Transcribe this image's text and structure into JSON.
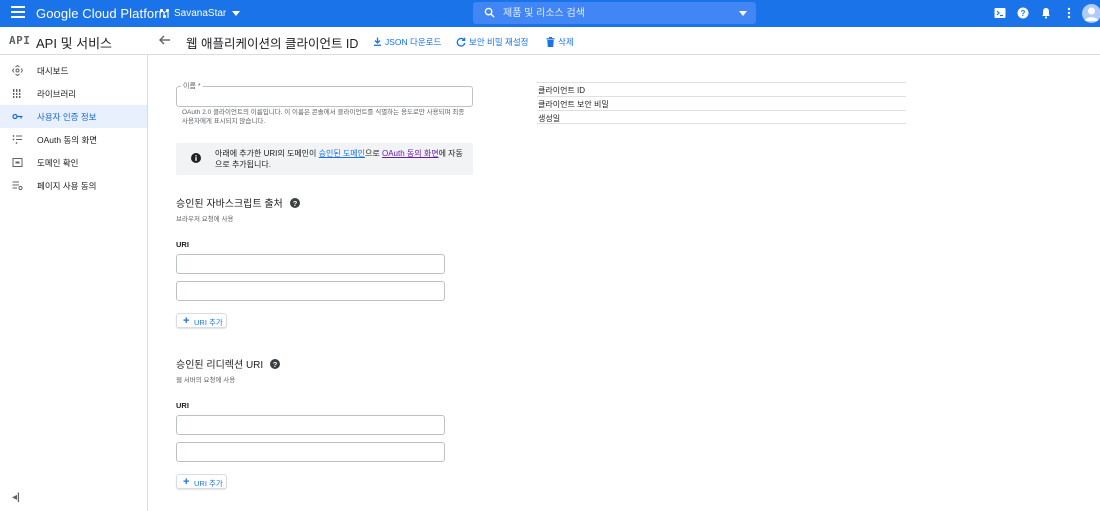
{
  "topbar": {
    "brand": "Google Cloud Platform",
    "project": "SavanaStar",
    "search_placeholder": "제품 및 리소스 검색",
    "accent": "#1a73e8"
  },
  "subheader": {
    "api_logo": "API",
    "api_title": "API 및 서비스",
    "page_title": "웹 애플리케이션의 클라이언트 ID",
    "actions": {
      "download": "JSON 다운로드",
      "reset": "보안 비밀 재설정",
      "delete": "삭제"
    }
  },
  "sidebar": {
    "items": [
      {
        "label": "대시보드",
        "icon": "dashboard-icon"
      },
      {
        "label": "라이브러리",
        "icon": "library-icon"
      },
      {
        "label": "사용자 인증 정보",
        "icon": "key-icon",
        "active": true
      },
      {
        "label": "OAuth 동의 화면",
        "icon": "consent-icon"
      },
      {
        "label": "도메인 확인",
        "icon": "domain-icon"
      },
      {
        "label": "페이지 사용 동의",
        "icon": "page-consent-icon"
      }
    ],
    "collapse": "◂|"
  },
  "form": {
    "name_label": "이름 *",
    "name_value": "",
    "name_help": "OAuth 2.0 클라이언트의 이름입니다. 이 이름은 콘솔에서 클라이언트를 식별하는 용도로만 사용되며 최종 사용자에게 표시되지 않습니다.",
    "info": {
      "part1": "아래에 추가한 URI의 도메인이 ",
      "link1": "승인된 도메인",
      "part2": "으로 ",
      "link2": "OAuth 동의 화면",
      "part3": "에 자동으로 추가됩니다."
    },
    "js_origins": {
      "title": "승인된 자바스크립트 출처",
      "subtitle": "브라우저 요청에 사용",
      "uri_label": "URI",
      "uris": [
        "",
        ""
      ],
      "add_label": "URI 추가"
    },
    "redirect_uris": {
      "title": "승인된 리디렉션 URI",
      "subtitle": "웹 서버의 요청에 사용",
      "uri_label": "URI",
      "uris": [
        "",
        ""
      ],
      "add_label": "URI 추가"
    }
  },
  "client_info": {
    "rows": [
      "클라이언트 ID",
      "클라이언트 보안 비밀",
      "생성일"
    ]
  }
}
